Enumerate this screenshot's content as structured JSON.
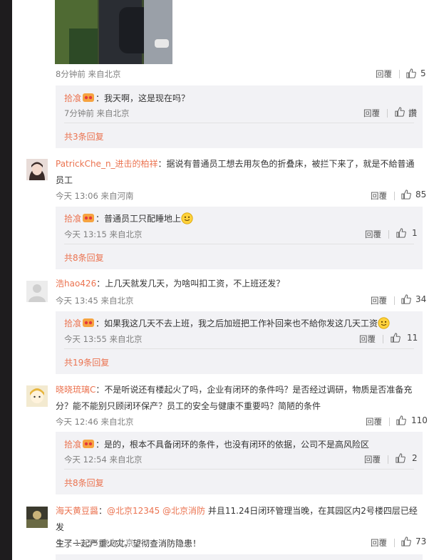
{
  "top": {
    "meta": "8分钟前 来自北京",
    "reply_label": "回覆",
    "like_count": "5",
    "reply": {
      "user": "拾飡",
      "text": "：我天啊，这是现在吗？",
      "meta": "7分钟前 来自北京",
      "reply_label": "回覆",
      "like_label": "讚"
    },
    "more": "共3条回复"
  },
  "comments": [
    {
      "name": "PatrickChe_n_进击的柏祥",
      "text": "：据说有普通员工想去用灰色的折叠床，被拦下来了，就是不給普通员工",
      "meta": "今天 13:06 来自河南",
      "reply_label": "回覆",
      "likes": "85",
      "reply": {
        "user": "拾飡",
        "text": "：普通员工只配睡地上",
        "meta": "今天 13:15 来自北京",
        "reply_label": "回覆",
        "likes": "1"
      },
      "more": "共8条回复"
    },
    {
      "name": "浩hao426",
      "text": "：上几天就发几天，为啥叫扣工资，不上班还发？",
      "meta": "今天 13:45 来自北京",
      "reply_label": "回覆",
      "likes": "34",
      "reply": {
        "user": "拾飡",
        "text": "：如果我这几天不去上班，我之后加班把工作补回来也不給你发这几天工资",
        "meta": "今天 13:55 来自北京",
        "reply_label": "回覆",
        "likes": "11"
      },
      "more": "共19条回复"
    },
    {
      "name": "晓晓琉璃C",
      "text_line1": "：不是听说还有楼起火了吗，企业有闭环的条件吗？是否经过调研，物质是否准备充",
      "text_line2": "分？能不能别只顾闭环保产？员工的安全与健康不重要吗？简陋的条件",
      "meta": "今天 12:46 来自北京",
      "reply_label": "回覆",
      "likes": "110",
      "reply": {
        "user": "拾飡",
        "text": "：是的，根本不具备闭环的条件，也没有闭环的依据，公司不是高风险区",
        "meta": "今天 12:54 来自北京",
        "reply_label": "回覆",
        "likes": "2"
      },
      "more": "共8条回复"
    },
    {
      "name": "海天黄豆醤",
      "mention1": "@北京12345",
      "mention2": "@北京消防",
      "text_line1": " 并且11.24日闭环管理当晚，在其园区内2号楼四层已经发",
      "text_line2": "生了一起严重火灾，望彻查消防隐患！",
      "meta": "今天 13:55 来自北京",
      "reply_label": "回覆",
      "likes": "73"
    }
  ],
  "icons": {
    "thumb": "thumbs-up-icon",
    "badge": "fan-badge-icon",
    "emoji": "smiley-emoji-icon"
  },
  "colors": {
    "username": "#eb7350",
    "meta": "#808080",
    "reply_bg": "#f2f2f5",
    "sidebar": "#1e1c1e"
  }
}
